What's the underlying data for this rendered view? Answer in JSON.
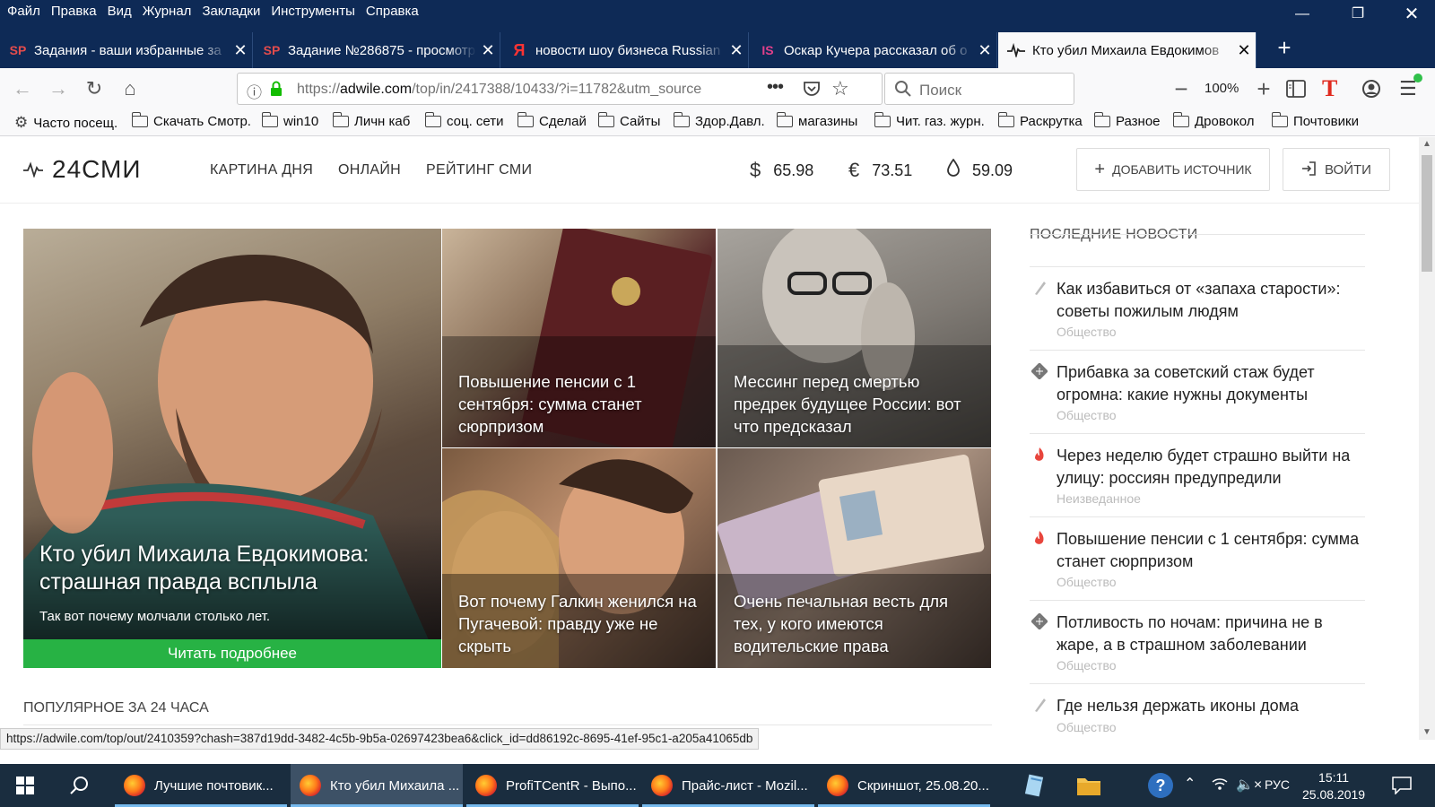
{
  "window": {
    "menu": [
      "Файл",
      "Правка",
      "Вид",
      "Журнал",
      "Закладки",
      "Инструменты",
      "Справка"
    ]
  },
  "tabs": [
    {
      "icon": "SP",
      "title": "Задания - ваши избранные за"
    },
    {
      "icon": "SP",
      "title": "Задание №286875 - просмотр"
    },
    {
      "icon": "Я",
      "title": "новости шоу бизнеса Russian"
    },
    {
      "icon": "IS",
      "title": "Оскар Кучера рассказал об о"
    },
    {
      "icon": "pulse",
      "title": "Кто убил Михаила Евдокимов"
    }
  ],
  "nav": {
    "url_prefix": "https://",
    "url_domain": "adwile.com",
    "url_rest": "/top/in/2417388/10433/?i=11782&utm_source",
    "zoom": "100%",
    "search_placeholder": "Поиск"
  },
  "bookmarks": [
    "Часто посещ.",
    "Скачать Смотр.",
    "win10",
    "Личн каб",
    "соц. сети",
    "Сделай",
    "Сайты",
    "Здор.Давл.",
    "магазины",
    "Чит. газ. журн.",
    "Раскрутка",
    "Разное",
    "Дровокол",
    "Почтовики"
  ],
  "site": {
    "logo": "24СМИ",
    "nav": [
      "КАРТИНА ДНЯ",
      "ОНЛАЙН",
      "РЕЙТИНГ СМИ"
    ],
    "rates": [
      {
        "symbol": "$",
        "value": "65.98"
      },
      {
        "symbol": "€",
        "value": "73.51"
      },
      {
        "symbol": "oil",
        "value": "59.09"
      }
    ],
    "add_source": "ДОБАВИТЬ ИСТОЧНИК",
    "login": "ВОЙТИ"
  },
  "main_story": {
    "title": "Кто убил Михаила Евдокимова: страшная правда всплыла",
    "subtitle": "Так вот почему молчали столько лет.",
    "cta": "Читать подробнее"
  },
  "cards": [
    {
      "title": "Повышение пенсии с 1 сентября: сумма станет сюрпризом"
    },
    {
      "title": "Мессинг перед смертью предрек будущее России: вот что предсказал"
    },
    {
      "title": "Вот почему Галкин женился на Пугачевой: правду уже не скрыть"
    },
    {
      "title": "Очень печальная весть для тех, у кого имеются водительские права"
    }
  ],
  "latest": {
    "heading": "ПОСЛЕДНИЕ НОВОСТИ",
    "items": [
      {
        "icon": "feather-icon",
        "title": "Как избавиться от «запаха старости»: советы пожилым людям",
        "category": "Общество"
      },
      {
        "icon": "grid-icon",
        "title": "Прибавка за советский стаж будет огромна: какие нужны документы",
        "category": "Общество"
      },
      {
        "icon": "fire-icon",
        "title": "Через неделю будет страшно выйти на улицу: россиян предупредили",
        "category": "Неизведанное"
      },
      {
        "icon": "fire-icon",
        "title": "Повышение пенсии с 1 сентября: сумма станет сюрпризом",
        "category": "Общество"
      },
      {
        "icon": "grid-icon",
        "title": "Потливость по ночам: причина не в жаре, а в страшном заболевании",
        "category": "Общество"
      },
      {
        "icon": "feather-icon",
        "title": "Где нельзя держать иконы дома",
        "category": "Общество"
      }
    ]
  },
  "popular_heading": "ПОПУЛЯРНОЕ ЗА 24 ЧАСА",
  "status_url": "https://adwile.com/top/out/2410359?chash=387d19dd-3482-4c5b-9b5a-02697423bea6&click_id=dd86192c-8695-41ef-95c1-a205a41065db",
  "taskbar": {
    "apps": [
      "Лучшие почтовик...",
      "Кто убил Михаила ...",
      "ProfiTCentR - Выпо...",
      "Прайс-лист - Mozil...",
      "Скриншот, 25.08.20..."
    ],
    "lang": "РУС",
    "time": "15:11",
    "date": "25.08.2019"
  },
  "colors": {
    "accent_green": "#27b244",
    "titlebar": "#0e2a56",
    "fire": "#e8453c"
  }
}
